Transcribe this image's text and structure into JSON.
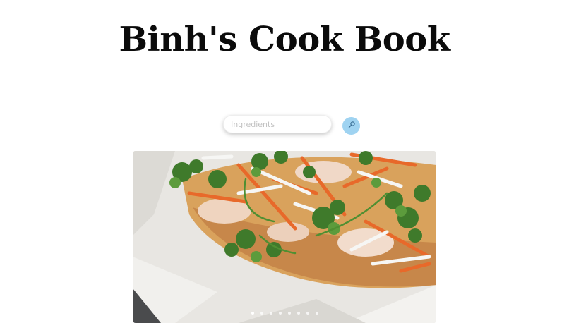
{
  "header": {
    "title": "Binh's Cook Book"
  },
  "search": {
    "placeholder": "Ingredients",
    "value": "",
    "button_icon": "search-icon",
    "button_color": "#9fd3f1"
  },
  "carousel": {
    "slide_image": "banh-mi-sandwich-photo",
    "slide_count": 8,
    "active_index": 0
  }
}
